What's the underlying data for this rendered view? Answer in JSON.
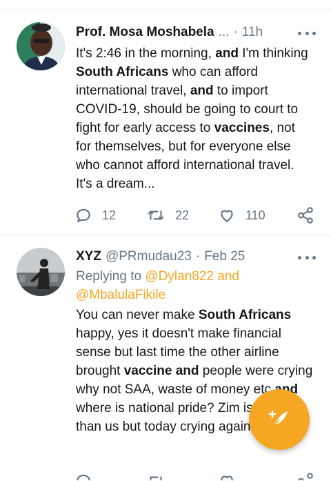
{
  "colors": {
    "accent": "#f5a623",
    "muted": "#657786",
    "text": "#14171a",
    "divider": "#e6ecf0"
  },
  "tweets": [
    {
      "author": "Prof. Mosa Moshabela",
      "ellipsis": "...",
      "time": "11h",
      "body": {
        "p1": "It's 2:46 in the morning, ",
        "b1": "and",
        "p2": " I'm thinking ",
        "b2": "South Africans",
        "p3": " who can afford international travel, ",
        "b3": "and",
        "p4": " to import COVID-19, should be going to court to fight for early access to ",
        "b4": "vaccines",
        "p5": ", not for themselves, but for everyone else who cannot afford international travel. It's a dream..."
      },
      "reply_count": "12",
      "retweet_count": "22",
      "like_count": "110"
    },
    {
      "author": "XYZ",
      "handle": "@PRmudau23",
      "time": "Feb 25",
      "replying_prefix": "Replying to ",
      "mention1": "@Dylan822",
      "and_word": " and ",
      "mention2": "@MbalulaFikile",
      "body": {
        "p1": "You can never make ",
        "b1": "South Africans",
        "p2": " happy, yes it doesn't make financial sense but last time the other airline brought ",
        "b2": "vaccine and",
        "p3": " people were crying why not SAA, waste of money etc ",
        "b3": "and",
        "p4": " where is national pride? Zim is better than us but today crying again."
      }
    }
  ],
  "icons": {
    "reply": "reply-icon",
    "retweet": "retweet-icon",
    "like": "heart-icon",
    "share": "share-icon",
    "more": "more-icon",
    "compose": "compose-icon"
  }
}
